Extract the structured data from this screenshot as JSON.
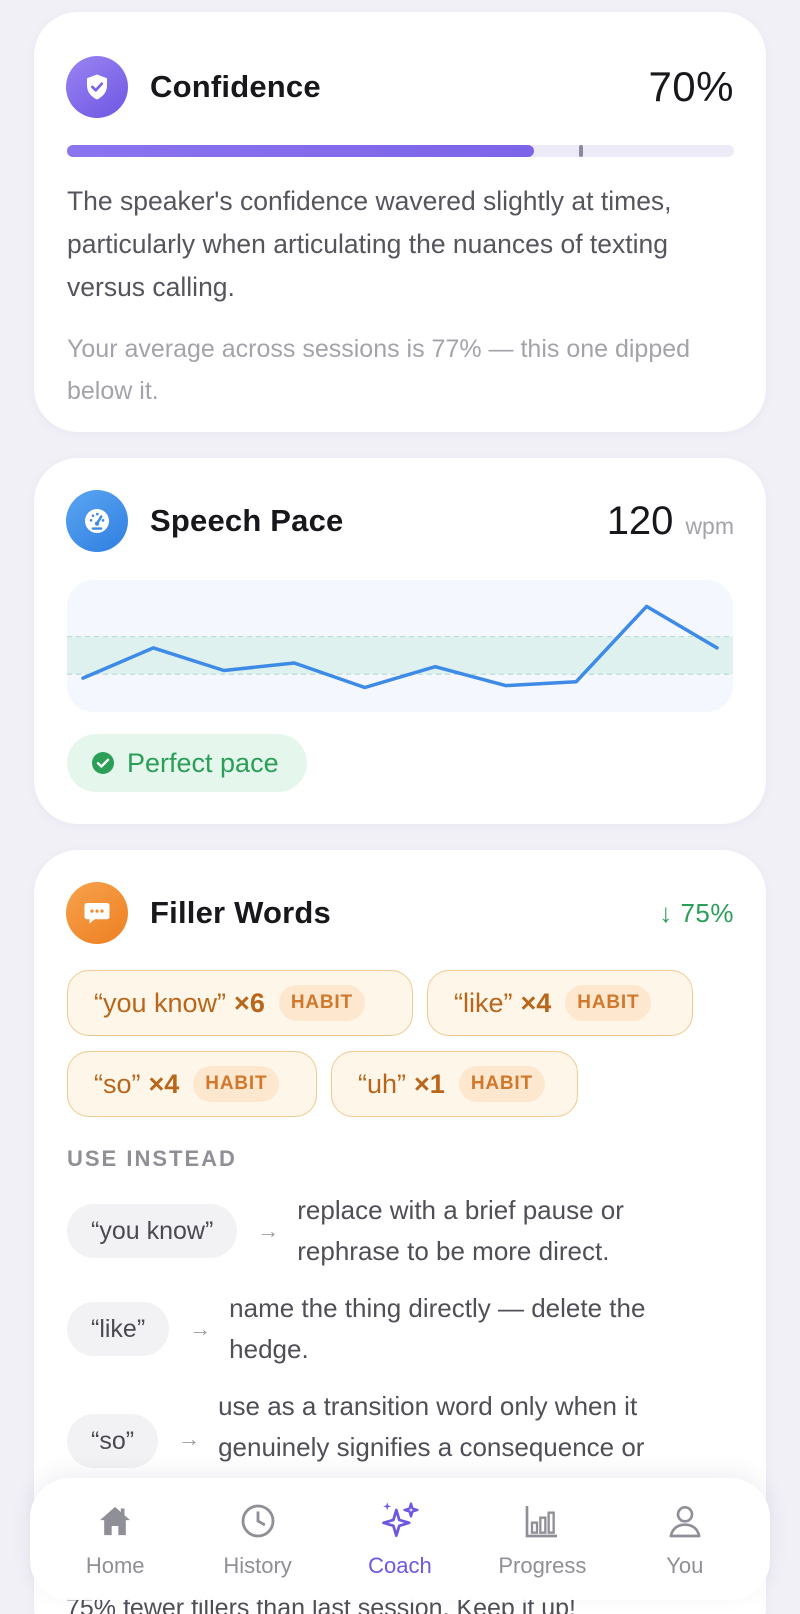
{
  "confidence": {
    "title": "Confidence",
    "value_label": "70%",
    "progress": 0.7,
    "average": 0.77,
    "description": "The speaker's confidence wavered slightly at times, particularly when articulating the nuances of texting versus calling.",
    "average_note": "Your average across sessions is 77% — this one dipped below it.",
    "icon": "shield-check-icon",
    "accent": "#7c63e8"
  },
  "pace": {
    "title": "Speech Pace",
    "value": "120",
    "unit": "wpm",
    "status": "Perfect pace",
    "icon": "speedometer-icon",
    "accent": "#3d8be6",
    "status_color": "#2b9e58"
  },
  "chart_data": {
    "type": "line",
    "values": [
      108,
      124,
      112,
      116,
      103,
      114,
      104,
      106,
      146,
      124
    ],
    "ylim": [
      90,
      160
    ],
    "target_band": [
      110,
      130
    ],
    "title": "",
    "xlabel": "",
    "ylabel": "",
    "grid": false
  },
  "filler": {
    "title": "Filler Words",
    "delta": "↓ 75%",
    "icon": "chat-bubble-icon",
    "accent": "#f08a2e",
    "chips": [
      {
        "word": "“you know”",
        "count": "×6",
        "tag": "HABIT"
      },
      {
        "word": "“like”",
        "count": "×4",
        "tag": "HABIT"
      },
      {
        "word": "“so”",
        "count": "×4",
        "tag": "HABIT"
      },
      {
        "word": "“uh”",
        "count": "×1",
        "tag": "HABIT"
      }
    ],
    "use_instead_label": "USE INSTEAD",
    "alternatives": [
      {
        "word": "“you know”",
        "text": "replace with a brief pause or rephrase to be more direct."
      },
      {
        "word": "“like”",
        "text": "name the thing directly — delete the hedge."
      },
      {
        "word": "“so”",
        "text": "use as a transition word only when it genuinely signifies a consequence or"
      }
    ],
    "footer_note": "75% fewer fillers than last session. Keep it up!"
  },
  "nav": {
    "items": [
      {
        "label": "Home",
        "icon": "home-icon"
      },
      {
        "label": "History",
        "icon": "clock-icon"
      },
      {
        "label": "Coach",
        "icon": "sparkles-icon"
      },
      {
        "label": "Progress",
        "icon": "bar-chart-icon"
      },
      {
        "label": "You",
        "icon": "user-icon"
      }
    ],
    "active": "Coach"
  }
}
